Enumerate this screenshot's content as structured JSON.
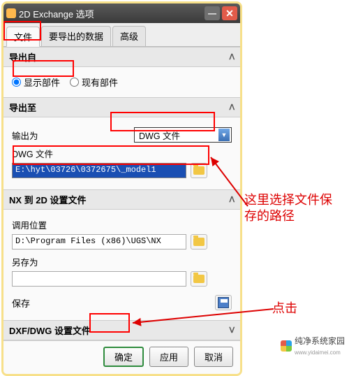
{
  "window": {
    "title": "2D Exchange 选项"
  },
  "tabs": {
    "file": "文件",
    "exportData": "要导出的数据",
    "advanced": "高级"
  },
  "exportFrom": {
    "header": "导出自",
    "showParts": "显示部件",
    "existingParts": "现有部件"
  },
  "exportTo": {
    "header": "导出至",
    "outputAsLabel": "输出为",
    "outputAsValue": "DWG 文件",
    "dwgLabel": "DWG 文件",
    "pathValue": "E:\\hyt\\03726\\0372675\\_model1"
  },
  "nxSettings": {
    "header": "NX 到 2D 设置文件",
    "invokeLabel": "调用位置",
    "invokeValue": "D:\\Program Files (x86)\\UGS\\NX",
    "saveAsLabel": "另存为",
    "saveAsValue": "",
    "saveLabel": "保存"
  },
  "dxfSettings": {
    "header": "DXF/DWG 设置文件"
  },
  "footer": {
    "ok": "确定",
    "apply": "应用",
    "cancel": "取消"
  },
  "annotations": {
    "pathNote": "这里选择文件保存的路径",
    "clickNote": "点击"
  },
  "watermark": {
    "brand": "纯净系统家园",
    "url": "www.yidaimei.com"
  }
}
